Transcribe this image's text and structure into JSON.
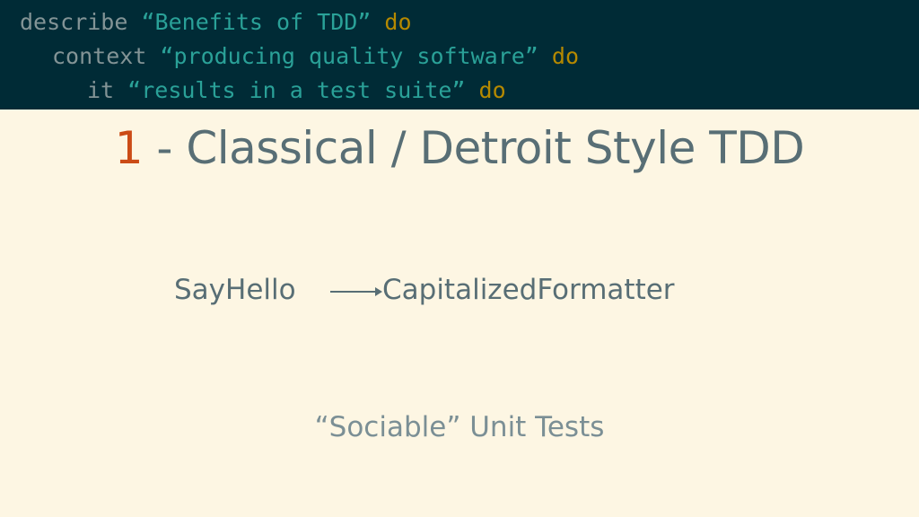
{
  "code": {
    "line1": {
      "keyword": "describe",
      "string": "“Benefits of TDD”",
      "end": "do"
    },
    "line2": {
      "keyword": "context",
      "string": "“producing quality software”",
      "end": "do"
    },
    "line3": {
      "keyword": "it",
      "string": "“results in a test suite”",
      "end": "do"
    }
  },
  "title": {
    "number": "1",
    "text": " - Classical / Detroit Style TDD"
  },
  "diagram": {
    "from": "SayHello",
    "to": "CapitalizedFormatter"
  },
  "subtitle": "“Sociable” Unit Tests",
  "colors": {
    "header_bg": "#002B36",
    "page_bg": "#FDF6E3",
    "accent_orange": "#CB4B16",
    "string_teal": "#2AA198",
    "keyword_do": "#B58900",
    "text_gray": "#586E75"
  }
}
